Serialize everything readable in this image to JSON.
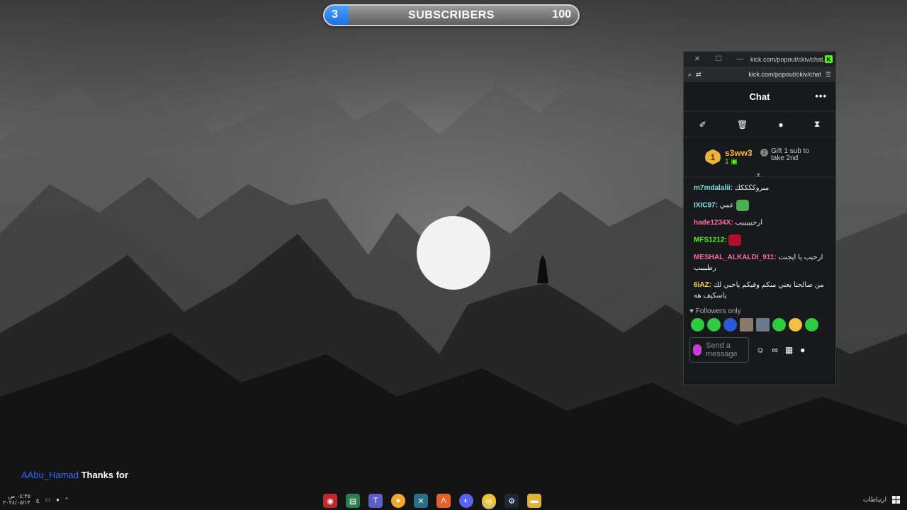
{
  "overlay": {
    "subscribers": {
      "current": "3",
      "label": "SUBSCRIBERS",
      "goal": "100",
      "progress": 0.03
    }
  },
  "chat_window": {
    "titlebar": {
      "url": "kick.com/popout/ckiv/chat..."
    },
    "addressbar": {
      "url": "kick.com/popout/ckiv/chat"
    },
    "header": {
      "title": "Chat",
      "more": "•••"
    },
    "leaderboard": {
      "rank": "1",
      "name": "s3ww3",
      "count": "1",
      "gift_rank": "2",
      "gift_text_1": "Gift 1 sub to",
      "gift_text_2": "take 2nd"
    },
    "messages": [
      {
        "user": "m7mdalalii:",
        "text": "مبروككككك",
        "color": "#7fe0e0"
      },
      {
        "user": "IXIC97:",
        "text": "عمي",
        "color": "#7fe0e0",
        "emote": "#4caf50"
      },
      {
        "user": "hade1234X:",
        "text": "ارحبببببب",
        "color": "#ff6b9a"
      },
      {
        "user": "MFS1212:",
        "text": "",
        "color": "#53fc18",
        "emote": "#b0102a"
      },
      {
        "user": "MESHAL_ALKALDI_911:",
        "text": "ارحبب يا ايجنت رطبببب",
        "color": "#ff6b9a"
      },
      {
        "user": "6iAZ:",
        "text": "من صالحنا يعني منكم وفيكم ياحبي لك ياسكيف هه",
        "color": "#ffd34d"
      }
    ],
    "followers_label": "Followers only",
    "input_placeholder": "Send a message"
  },
  "stream_chat": {
    "user": "AAbu_Hamad",
    "message": "Thanks for"
  },
  "taskbar": {
    "time": "٠٤:٢٥ ص",
    "date": "٢٠٢٤/٠٥/١٣",
    "lang": "ع",
    "connections": "ارتباطات"
  }
}
